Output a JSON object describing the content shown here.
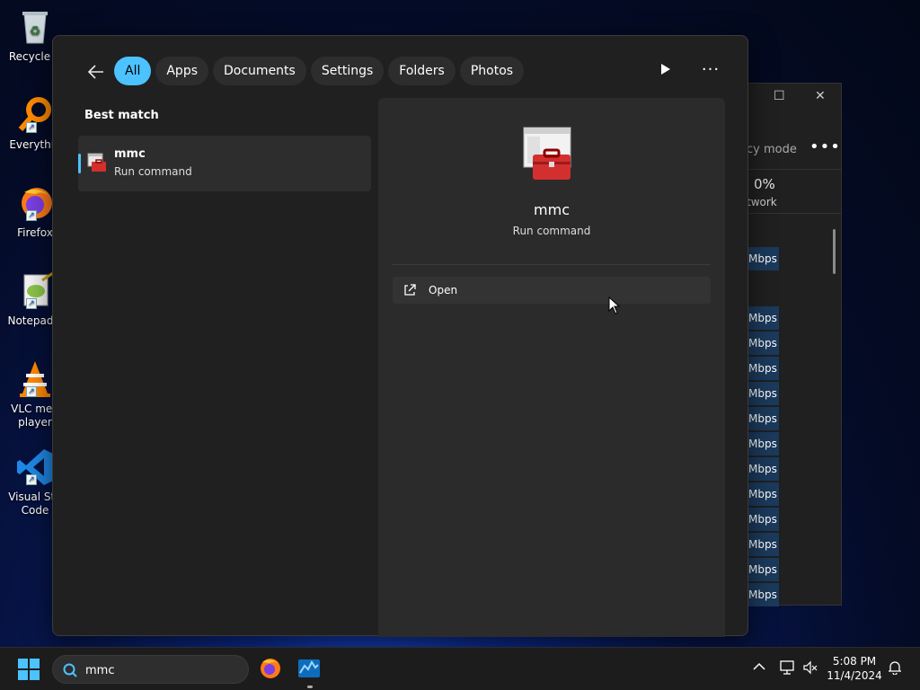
{
  "desktop": {
    "icons": [
      {
        "label": "Recycle B"
      },
      {
        "label": "Everythin"
      },
      {
        "label": "Firefox"
      },
      {
        "label": "Notepad+"
      },
      {
        "label_line1": "VLC med",
        "label_line2": "player"
      },
      {
        "label_line1": "Visual Stu",
        "label_line2": "Code"
      }
    ]
  },
  "background_window": {
    "mode_text": "cy mode",
    "more_label": "•••",
    "cpu_percent": "0%",
    "column_label": "twork",
    "unit": "Mbps",
    "row_count": 13
  },
  "search": {
    "filters": [
      {
        "label": "All",
        "active": true
      },
      {
        "label": "Apps"
      },
      {
        "label": "Documents"
      },
      {
        "label": "Settings"
      },
      {
        "label": "Folders"
      },
      {
        "label": "Photos"
      }
    ],
    "more_label": "···",
    "best_match_label": "Best match",
    "best_match": {
      "name": "mmc",
      "subtitle": "Run command"
    },
    "preview": {
      "name": "mmc",
      "subtitle": "Run command",
      "action_open": "Open"
    }
  },
  "taskbar": {
    "search_value": "mmc",
    "time": "5:08 PM",
    "date": "11/4/2024"
  },
  "colors": {
    "accent": "#4cc2ff",
    "panel_bg": "#202020",
    "preview_bg": "#2b2b2b"
  }
}
